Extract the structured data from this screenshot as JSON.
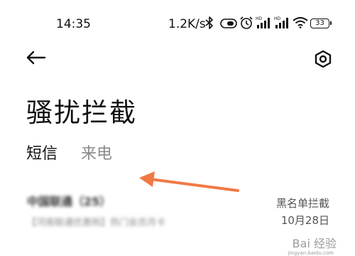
{
  "status_bar": {
    "time": "14:35",
    "net_speed": "1.2K/s",
    "battery": "33",
    "icons": [
      "bluetooth-icon",
      "vibrate-icon",
      "alarm-icon",
      "signal-hd-icon",
      "signal-hd-icon",
      "wifi-icon",
      "battery-icon"
    ]
  },
  "header": {
    "back_icon": "back-arrow-icon",
    "settings_icon": "settings-icon"
  },
  "page": {
    "title": "骚扰拦截"
  },
  "tabs": [
    {
      "label": "短信",
      "active": true
    },
    {
      "label": "来电",
      "active": false
    }
  ],
  "messages": [
    {
      "sender": "中国联通（25）",
      "snippet": "【河南联通优惠购】热门会员月卡",
      "tag": "黑名单拦截",
      "date": "10月28日"
    }
  ],
  "annotation": {
    "color": "#f07a45"
  },
  "watermark": {
    "text": "Bai 经验",
    "url": "jingyan.baidu.com"
  },
  "colors": {
    "text": "#111111",
    "muted": "#8a8a8a",
    "accent": "#f07a45"
  }
}
